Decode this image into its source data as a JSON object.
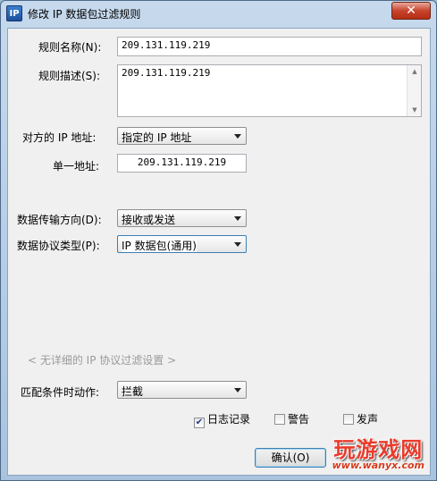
{
  "window": {
    "title": "修改 IP 数据包过滤规则",
    "icon_label": "IP",
    "close_label": "✕"
  },
  "form": {
    "rule_name_label": "规则名称(N):",
    "rule_name_value": "209.131.119.219",
    "rule_desc_label": "规则描述(S):",
    "rule_desc_value": "209.131.119.219",
    "remote_ip_label": "对方的 IP 地址:",
    "remote_ip_value": "指定的 IP 地址",
    "single_addr_label": "单一地址:",
    "single_addr_value": "209.131.119.219",
    "direction_label": "数据传输方向(D):",
    "direction_value": "接收或发送",
    "protocol_label": "数据协议类型(P):",
    "protocol_value": "IP 数据包(通用)",
    "no_detail_text": "< 无详细的 IP 协议过滤设置 >",
    "action_label": "匹配条件时动作:",
    "action_value": "拦截",
    "log_label": "日志记录",
    "log_checked": true,
    "alert_label": "警告",
    "alert_checked": false,
    "sound_label": "发声",
    "sound_checked": false,
    "ok_label": "确认(O)"
  },
  "watermark": {
    "title": "玩游戏网",
    "url": "www.wanyx.com"
  }
}
